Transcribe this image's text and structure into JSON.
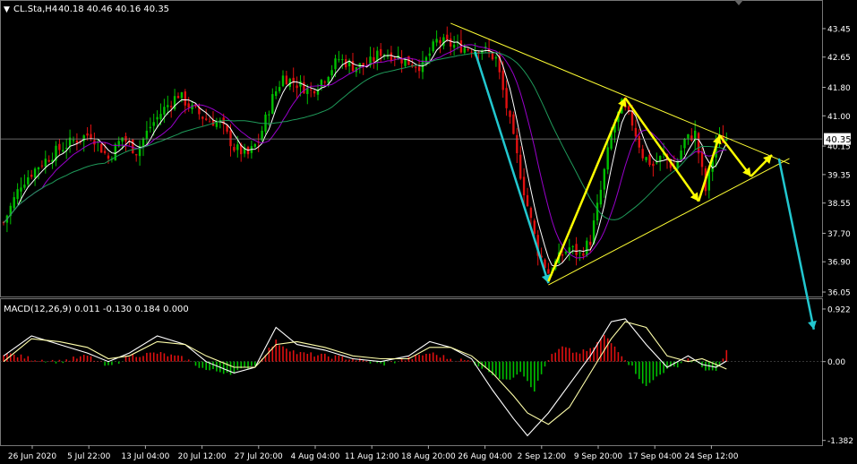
{
  "header": {
    "symbol_label": "CL.Sta,H4",
    "ohlc_text": "40.18 40.46 40.16 40.35"
  },
  "macd_header": "MACD(12,26,9) 0.011 -0.130 0.184 0.000",
  "current_price_label": "40.35",
  "colors": {
    "background": "#000000",
    "bull": "#00c000",
    "bear": "#e01010",
    "ma_fast": "#ffffff",
    "ma_mid": "#9900cc",
    "ma_slow": "#1f9a5a",
    "trendline": "#ffff33",
    "arrow_cyan": "#22c7cf",
    "arrow_yellow": "#ffff00",
    "macd_signal": "#ffffaa",
    "grid": "#666666"
  },
  "chart_data": [
    {
      "type": "candlestick",
      "title": "CL.Sta,H4",
      "price_axis_ticks": [
        "43.45",
        "42.65",
        "41.80",
        "41.00",
        "40.15",
        "39.35",
        "38.55",
        "37.70",
        "36.90",
        "36.05"
      ],
      "time_axis_ticks": [
        "26 Jun 2020",
        "5 Jul 22:00",
        "13 Jul 04:00",
        "20 Jul 12:00",
        "27 Jul 20:00",
        "4 Aug 04:00",
        "11 Aug 12:00",
        "18 Aug 20:00",
        "26 Aug 04:00",
        "2 Sep 12:00",
        "9 Sep 20:00",
        "17 Sep 04:00",
        "24 Sep 12:00"
      ],
      "ylim": [
        35.95,
        43.7
      ],
      "last_price": 40.35,
      "close_path": [
        {
          "t": 0,
          "c": 38.0
        },
        {
          "t": 5,
          "c": 39.1
        },
        {
          "t": 10,
          "c": 39.6
        },
        {
          "t": 15,
          "c": 40.0
        },
        {
          "t": 20,
          "c": 40.3
        },
        {
          "t": 25,
          "c": 40.5
        },
        {
          "t": 30,
          "c": 39.8
        },
        {
          "t": 34,
          "c": 40.4
        },
        {
          "t": 38,
          "c": 40.0
        },
        {
          "t": 42,
          "c": 40.7
        },
        {
          "t": 46,
          "c": 41.2
        },
        {
          "t": 50,
          "c": 41.6
        },
        {
          "t": 54,
          "c": 41.2
        },
        {
          "t": 58,
          "c": 40.9
        },
        {
          "t": 62,
          "c": 40.8
        },
        {
          "t": 66,
          "c": 40.1
        },
        {
          "t": 70,
          "c": 39.9
        },
        {
          "t": 73,
          "c": 40.3
        },
        {
          "t": 77,
          "c": 41.5
        },
        {
          "t": 80,
          "c": 42.1
        },
        {
          "t": 84,
          "c": 41.9
        },
        {
          "t": 88,
          "c": 41.7
        },
        {
          "t": 92,
          "c": 42.1
        },
        {
          "t": 96,
          "c": 42.6
        },
        {
          "t": 100,
          "c": 42.4
        },
        {
          "t": 104,
          "c": 42.4
        },
        {
          "t": 108,
          "c": 42.8
        },
        {
          "t": 112,
          "c": 42.7
        },
        {
          "t": 116,
          "c": 42.5
        },
        {
          "t": 120,
          "c": 42.4
        },
        {
          "t": 124,
          "c": 43.1
        },
        {
          "t": 128,
          "c": 43.0
        },
        {
          "t": 133,
          "c": 42.9
        },
        {
          "t": 137,
          "c": 42.9
        },
        {
          "t": 141,
          "c": 42.6
        },
        {
          "t": 145,
          "c": 40.8
        },
        {
          "t": 149,
          "c": 38.9
        },
        {
          "t": 153,
          "c": 37.2
        },
        {
          "t": 156,
          "c": 36.6
        },
        {
          "t": 159,
          "c": 37.0
        },
        {
          "t": 162,
          "c": 37.3
        },
        {
          "t": 165,
          "c": 37.1
        },
        {
          "t": 168,
          "c": 37.5
        },
        {
          "t": 171,
          "c": 38.9
        },
        {
          "t": 174,
          "c": 40.5
        },
        {
          "t": 177,
          "c": 41.3
        },
        {
          "t": 180,
          "c": 40.8
        },
        {
          "t": 183,
          "c": 39.9
        },
        {
          "t": 186,
          "c": 39.6
        },
        {
          "t": 189,
          "c": 39.9
        },
        {
          "t": 192,
          "c": 39.5
        },
        {
          "t": 195,
          "c": 40.3
        },
        {
          "t": 198,
          "c": 40.5
        },
        {
          "t": 201,
          "c": 38.9
        },
        {
          "t": 204,
          "c": 40.3
        },
        {
          "t": 207,
          "c": 40.35
        }
      ],
      "trendlines": [
        {
          "name": "upper",
          "from": {
            "t": 128,
            "p": 43.6
          },
          "to": {
            "t": 225,
            "p": 39.65
          }
        },
        {
          "name": "lower",
          "from": {
            "t": 156,
            "p": 36.25
          },
          "to": {
            "t": 225,
            "p": 39.8
          }
        }
      ],
      "arrows": [
        {
          "color": "arrow_cyan",
          "from": {
            "t": 135,
            "p": 42.8
          },
          "to": {
            "t": 156,
            "p": 36.3
          }
        },
        {
          "color": "arrow_yellow",
          "from": {
            "t": 156,
            "p": 36.35
          },
          "to": {
            "t": 178,
            "p": 41.5
          }
        },
        {
          "color": "arrow_yellow",
          "from": {
            "t": 178,
            "p": 41.5
          },
          "to": {
            "t": 199,
            "p": 38.6
          }
        },
        {
          "color": "arrow_yellow",
          "from": {
            "t": 199,
            "p": 38.6
          },
          "to": {
            "t": 205,
            "p": 40.45
          }
        },
        {
          "color": "arrow_yellow",
          "from": {
            "t": 205,
            "p": 40.45
          },
          "to": {
            "t": 214,
            "p": 39.3
          }
        },
        {
          "color": "arrow_yellow",
          "from": {
            "t": 214,
            "p": 39.3
          },
          "to": {
            "t": 220,
            "p": 39.9
          }
        },
        {
          "color": "arrow_cyan",
          "from": {
            "t": 222,
            "p": 39.8
          },
          "to": {
            "t": 232,
            "p": 35.0
          }
        }
      ]
    },
    {
      "type": "bar",
      "title": "MACD(12,26,9)",
      "values_header": [
        "0.011",
        "-0.130",
        "0.184",
        "0.000"
      ],
      "axis_ticks": [
        "0.922",
        "0.00",
        "-1.382"
      ],
      "ylim": [
        -1.45,
        1.0
      ],
      "histogram_path": [
        {
          "t": 0,
          "v": 0.15
        },
        {
          "t": 8,
          "v": 0.05
        },
        {
          "t": 16,
          "v": 0.0
        },
        {
          "t": 24,
          "v": 0.1
        },
        {
          "t": 30,
          "v": -0.1
        },
        {
          "t": 36,
          "v": 0.1
        },
        {
          "t": 44,
          "v": 0.15
        },
        {
          "t": 52,
          "v": 0.05
        },
        {
          "t": 58,
          "v": -0.15
        },
        {
          "t": 66,
          "v": -0.2
        },
        {
          "t": 72,
          "v": -0.05
        },
        {
          "t": 78,
          "v": 0.35
        },
        {
          "t": 84,
          "v": 0.15
        },
        {
          "t": 92,
          "v": 0.1
        },
        {
          "t": 100,
          "v": 0.05
        },
        {
          "t": 108,
          "v": -0.05
        },
        {
          "t": 116,
          "v": 0.05
        },
        {
          "t": 122,
          "v": 0.15
        },
        {
          "t": 128,
          "v": 0.05
        },
        {
          "t": 134,
          "v": 0.0
        },
        {
          "t": 140,
          "v": -0.2
        },
        {
          "t": 144,
          "v": -0.35
        },
        {
          "t": 148,
          "v": -0.15
        },
        {
          "t": 152,
          "v": -0.5
        },
        {
          "t": 156,
          "v": 0.05
        },
        {
          "t": 160,
          "v": 0.25
        },
        {
          "t": 164,
          "v": 0.15
        },
        {
          "t": 168,
          "v": 0.2
        },
        {
          "t": 172,
          "v": 0.45
        },
        {
          "t": 176,
          "v": 0.2
        },
        {
          "t": 180,
          "v": -0.1
        },
        {
          "t": 184,
          "v": -0.45
        },
        {
          "t": 188,
          "v": -0.2
        },
        {
          "t": 192,
          "v": -0.1
        },
        {
          "t": 196,
          "v": 0.05
        },
        {
          "t": 200,
          "v": -0.1
        },
        {
          "t": 204,
          "v": -0.2
        },
        {
          "t": 207,
          "v": 0.184
        }
      ],
      "macd_path": [
        {
          "t": 0,
          "v": 0.1
        },
        {
          "t": 8,
          "v": 0.45
        },
        {
          "t": 16,
          "v": 0.3
        },
        {
          "t": 24,
          "v": 0.15
        },
        {
          "t": 30,
          "v": 0.0
        },
        {
          "t": 36,
          "v": 0.15
        },
        {
          "t": 44,
          "v": 0.45
        },
        {
          "t": 52,
          "v": 0.3
        },
        {
          "t": 58,
          "v": 0.0
        },
        {
          "t": 66,
          "v": -0.2
        },
        {
          "t": 72,
          "v": -0.1
        },
        {
          "t": 78,
          "v": 0.6
        },
        {
          "t": 84,
          "v": 0.3
        },
        {
          "t": 92,
          "v": 0.2
        },
        {
          "t": 100,
          "v": 0.05
        },
        {
          "t": 108,
          "v": 0.0
        },
        {
          "t": 116,
          "v": 0.1
        },
        {
          "t": 122,
          "v": 0.35
        },
        {
          "t": 128,
          "v": 0.25
        },
        {
          "t": 134,
          "v": 0.05
        },
        {
          "t": 140,
          "v": -0.5
        },
        {
          "t": 146,
          "v": -1.0
        },
        {
          "t": 150,
          "v": -1.3
        },
        {
          "t": 156,
          "v": -0.9
        },
        {
          "t": 162,
          "v": -0.4
        },
        {
          "t": 168,
          "v": 0.1
        },
        {
          "t": 174,
          "v": 0.7
        },
        {
          "t": 178,
          "v": 0.75
        },
        {
          "t": 184,
          "v": 0.3
        },
        {
          "t": 190,
          "v": -0.1
        },
        {
          "t": 196,
          "v": 0.1
        },
        {
          "t": 200,
          "v": -0.05
        },
        {
          "t": 204,
          "v": -0.1
        },
        {
          "t": 207,
          "v": 0.011
        }
      ],
      "signal_path": [
        {
          "t": 0,
          "v": 0.0
        },
        {
          "t": 8,
          "v": 0.4
        },
        {
          "t": 16,
          "v": 0.35
        },
        {
          "t": 24,
          "v": 0.25
        },
        {
          "t": 30,
          "v": 0.05
        },
        {
          "t": 36,
          "v": 0.1
        },
        {
          "t": 44,
          "v": 0.35
        },
        {
          "t": 52,
          "v": 0.3
        },
        {
          "t": 58,
          "v": 0.1
        },
        {
          "t": 66,
          "v": -0.1
        },
        {
          "t": 72,
          "v": -0.1
        },
        {
          "t": 78,
          "v": 0.3
        },
        {
          "t": 84,
          "v": 0.35
        },
        {
          "t": 92,
          "v": 0.25
        },
        {
          "t": 100,
          "v": 0.1
        },
        {
          "t": 108,
          "v": 0.05
        },
        {
          "t": 116,
          "v": 0.05
        },
        {
          "t": 122,
          "v": 0.25
        },
        {
          "t": 128,
          "v": 0.25
        },
        {
          "t": 134,
          "v": 0.1
        },
        {
          "t": 140,
          "v": -0.2
        },
        {
          "t": 146,
          "v": -0.6
        },
        {
          "t": 150,
          "v": -0.9
        },
        {
          "t": 156,
          "v": -1.1
        },
        {
          "t": 162,
          "v": -0.8
        },
        {
          "t": 168,
          "v": -0.2
        },
        {
          "t": 174,
          "v": 0.4
        },
        {
          "t": 178,
          "v": 0.7
        },
        {
          "t": 184,
          "v": 0.6
        },
        {
          "t": 190,
          "v": 0.1
        },
        {
          "t": 196,
          "v": 0.0
        },
        {
          "t": 200,
          "v": 0.05
        },
        {
          "t": 204,
          "v": -0.05
        },
        {
          "t": 207,
          "v": -0.13
        }
      ]
    }
  ]
}
